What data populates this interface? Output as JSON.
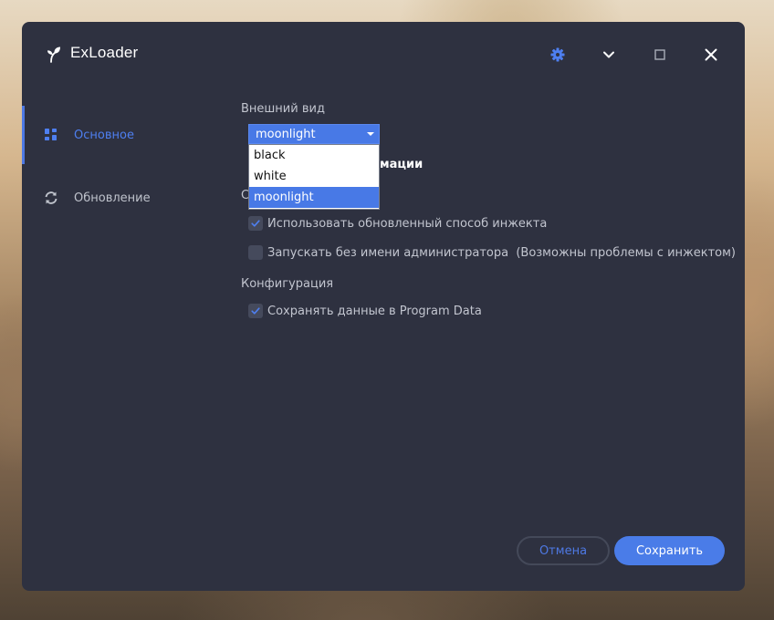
{
  "app": {
    "title": "ExLoader"
  },
  "titlebar": {
    "icons": [
      "gear-icon",
      "chevron-down-icon",
      "maximize-icon",
      "close-icon"
    ]
  },
  "sidebar": {
    "items": [
      {
        "label": "Основное",
        "icon": "dashboard-icon",
        "active": true
      },
      {
        "label": "Обновление",
        "icon": "refresh-icon",
        "active": false
      }
    ]
  },
  "appearance": {
    "title": "Внешний вид",
    "theme_select": {
      "value": "moonlight",
      "options": [
        "black",
        "white",
        "moonlight"
      ],
      "selected_index": 2
    },
    "partial_label": "мации"
  },
  "inject": {
    "partial_title": "С",
    "options": [
      {
        "label": "Использовать обновленный способ инжекта",
        "checked": true
      },
      {
        "label": "Запускать без имени администратора  (Возможны проблемы с инжектом)",
        "checked": false
      }
    ]
  },
  "config": {
    "title": "Конфигурация",
    "options": [
      {
        "label": "Сохранять данные в Program Data",
        "checked": true
      }
    ]
  },
  "footer": {
    "cancel_label": "Отмена",
    "save_label": "Сохранить"
  },
  "colors": {
    "accent": "#4a7ce8",
    "window_bg": "#2e3140",
    "text_muted": "#c2c5cf",
    "text_inactive": "#bfc3cc"
  }
}
